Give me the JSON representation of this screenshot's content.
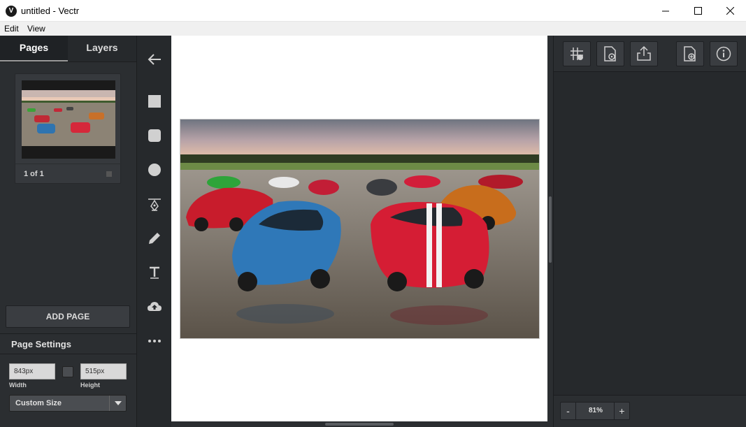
{
  "window": {
    "title": "untitled - Vectr",
    "app_icon_letter": "V"
  },
  "menu": {
    "items": [
      "Edit",
      "View"
    ]
  },
  "left_panel": {
    "tabs": [
      {
        "label": "Pages",
        "active": true
      },
      {
        "label": "Layers",
        "active": false
      }
    ],
    "page_thumbnail_label": "1 of 1",
    "add_page_label": "ADD PAGE",
    "page_settings_heading": "Page Settings",
    "width_value": "843px",
    "height_value": "515px",
    "width_caption": "Width",
    "height_caption": "Height",
    "size_preset": "Custom Size"
  },
  "toolbar": {
    "tools": [
      "back-arrow-icon",
      "rectangle-icon",
      "rounded-rectangle-icon",
      "ellipse-icon",
      "pen-tool-icon",
      "pencil-icon",
      "text-icon",
      "upload-icon",
      "more-icon"
    ]
  },
  "right_panel": {
    "buttons": [
      "grid-icon",
      "page-settings-icon",
      "export-icon",
      "add-page-icon",
      "info-icon"
    ],
    "zoom": {
      "minus": "-",
      "value": "81%",
      "plus": "+"
    }
  },
  "colors": {
    "panel_bg": "#2b2e31",
    "toolbar_bg": "#26292c",
    "canvas_bg": "#ffffff",
    "text_light": "#dcdcdc"
  }
}
